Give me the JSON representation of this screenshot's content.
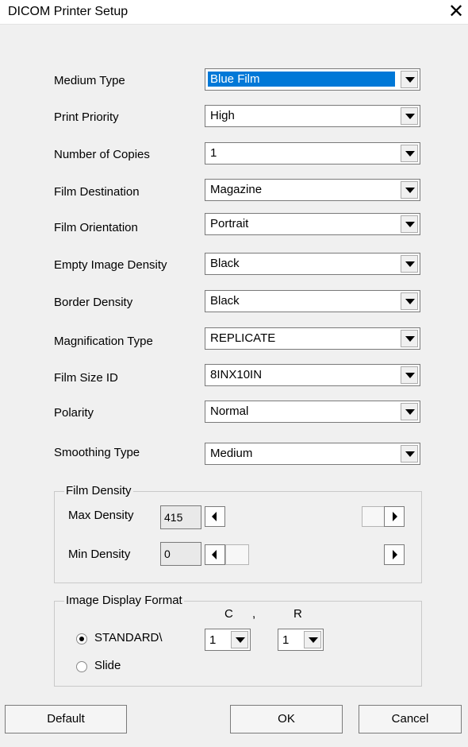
{
  "window": {
    "title": "DICOM Printer Setup",
    "close_glyph": "✕"
  },
  "fields": [
    {
      "label": "Medium Type",
      "value": "Blue Film"
    },
    {
      "label": "Print Priority",
      "value": "High"
    },
    {
      "label": "Number of Copies",
      "value": "1"
    },
    {
      "label": "Film Destination",
      "value": "Magazine"
    },
    {
      "label": "Film Orientation",
      "value": "Portrait"
    },
    {
      "label": "Empty Image Density",
      "value": "Black"
    },
    {
      "label": "Border Density",
      "value": "Black"
    },
    {
      "label": "Magnification Type",
      "value": "REPLICATE"
    },
    {
      "label": "Film Size ID",
      "value": "8INX10IN"
    },
    {
      "label": "Polarity",
      "value": "Normal"
    },
    {
      "label": "Smoothing Type",
      "value": "Medium"
    }
  ],
  "film_density": {
    "title": "Film Density",
    "max_label": "Max Density",
    "max_value": "415",
    "min_label": "Min Density",
    "min_value": "0"
  },
  "image_display_format": {
    "title": "Image Display Format",
    "col_header": "C",
    "separator": ",",
    "row_header": "R",
    "options": [
      "STANDARD\\",
      "Slide"
    ],
    "selected_option": "STANDARD\\",
    "columns": "1",
    "rows": "1"
  },
  "buttons": {
    "default": "Default",
    "ok": "OK",
    "cancel": "Cancel"
  }
}
